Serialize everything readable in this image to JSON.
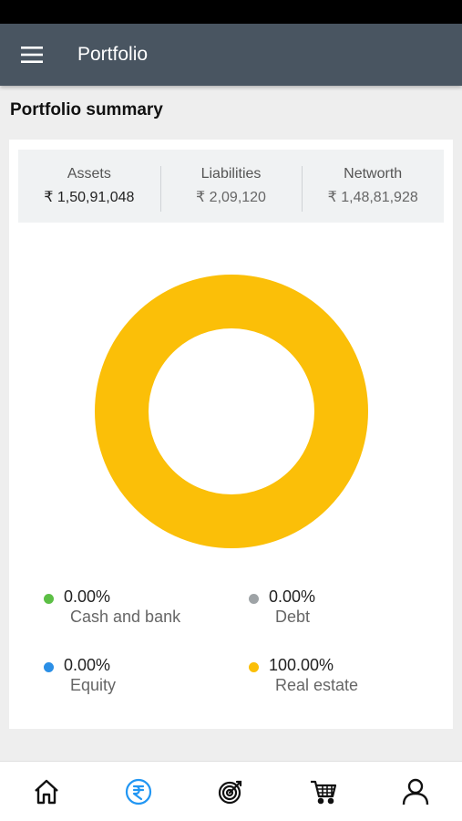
{
  "header": {
    "title": "Portfolio"
  },
  "section": {
    "title": "Portfolio summary"
  },
  "summary": {
    "assets": {
      "label": "Assets",
      "value": "₹ 1,50,91,048"
    },
    "liabilities": {
      "label": "Liabilities",
      "value": "₹ 2,09,120"
    },
    "networth": {
      "label": "Networth",
      "value": "₹ 1,48,81,928"
    }
  },
  "chart_data": {
    "type": "pie",
    "categories": [
      "Cash and bank",
      "Debt",
      "Equity",
      "Real estate"
    ],
    "values": [
      0.0,
      0.0,
      0.0,
      100.0
    ],
    "colors": [
      "#5cbf45",
      "#9ea3a6",
      "#2b8fe6",
      "#fbbf08"
    ]
  },
  "legend": [
    {
      "pct": "0.00%",
      "name": "Cash and bank",
      "color": "#5cbf45"
    },
    {
      "pct": "0.00%",
      "name": "Debt",
      "color": "#9ea3a6"
    },
    {
      "pct": "0.00%",
      "name": "Equity",
      "color": "#2b8fe6"
    },
    {
      "pct": "100.00%",
      "name": "Real estate",
      "color": "#fbbf08"
    }
  ],
  "nav": {
    "items": [
      "home-icon",
      "rupee-icon",
      "target-icon",
      "cart-icon",
      "profile-icon"
    ],
    "active": "rupee-icon",
    "active_color": "#2196f3"
  }
}
